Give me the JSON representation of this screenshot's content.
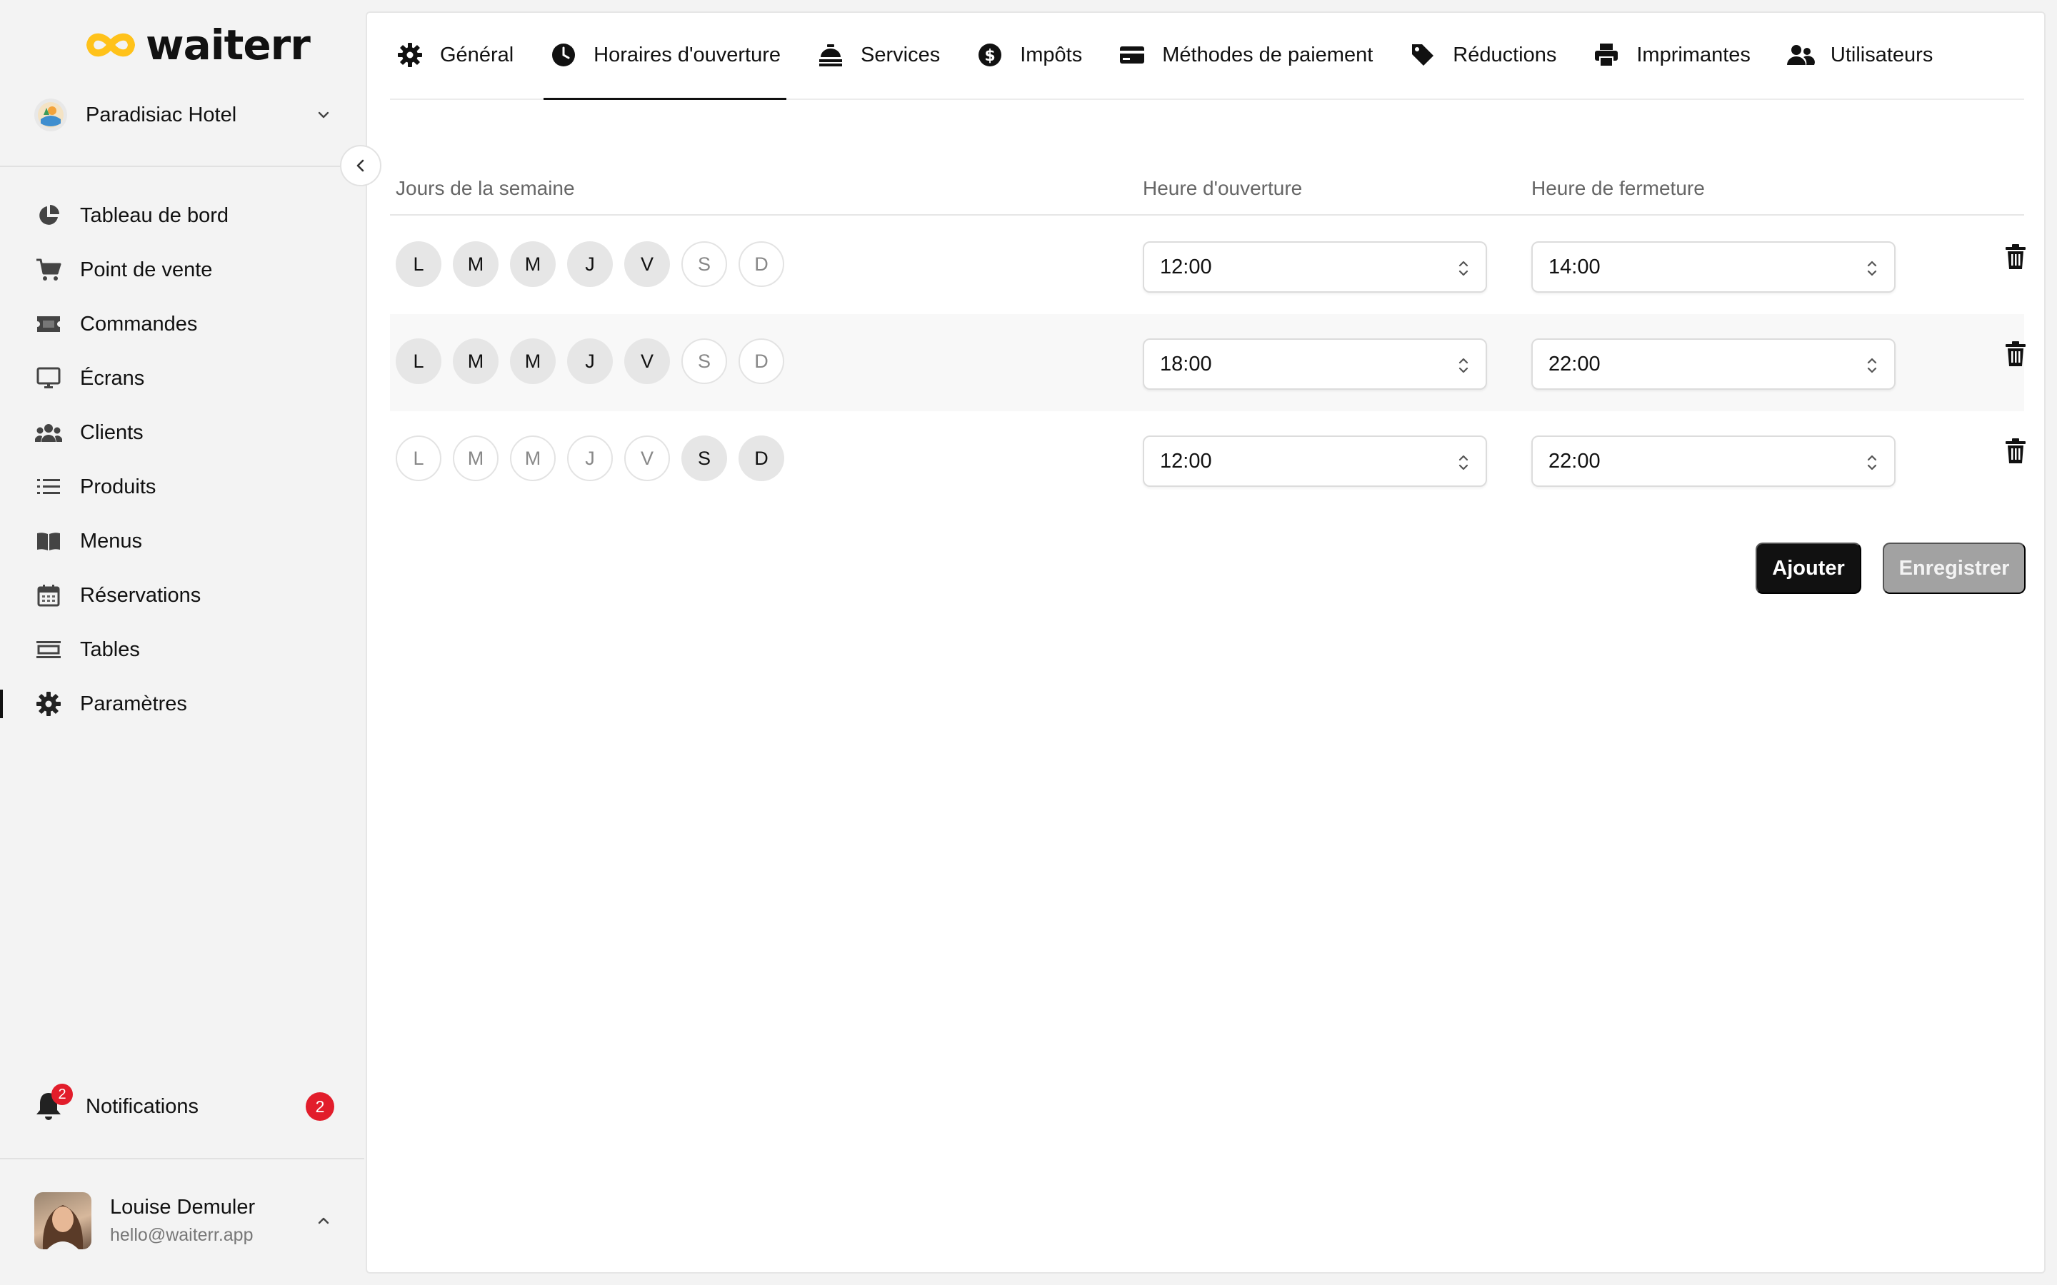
{
  "brand": {
    "name": "waiterr",
    "accent": "#FFC21A"
  },
  "workspace": {
    "name": "Paradisiac Hotel"
  },
  "nav": {
    "items": [
      {
        "label": "Tableau de bord",
        "icon": "pie-chart-icon"
      },
      {
        "label": "Point de vente",
        "icon": "cart-icon"
      },
      {
        "label": "Commandes",
        "icon": "ticket-icon"
      },
      {
        "label": "Écrans",
        "icon": "monitor-icon"
      },
      {
        "label": "Clients",
        "icon": "users-icon"
      },
      {
        "label": "Produits",
        "icon": "list-icon"
      },
      {
        "label": "Menus",
        "icon": "book-icon"
      },
      {
        "label": "Réservations",
        "icon": "calendar-icon"
      },
      {
        "label": "Tables",
        "icon": "table-icon"
      },
      {
        "label": "Paramètres",
        "icon": "gear-icon",
        "active": true
      }
    ]
  },
  "notifications": {
    "label": "Notifications",
    "count": "2"
  },
  "user": {
    "name": "Louise Demuler",
    "email": "hello@waiterr.app"
  },
  "tabs": [
    {
      "label": "Général",
      "icon": "gear-icon"
    },
    {
      "label": "Horaires d'ouverture",
      "icon": "clock-icon",
      "active": true
    },
    {
      "label": "Services",
      "icon": "bell-service-icon"
    },
    {
      "label": "Impôts",
      "icon": "dollar-coin-icon"
    },
    {
      "label": "Méthodes de paiement",
      "icon": "credit-card-icon"
    },
    {
      "label": "Réductions",
      "icon": "tag-icon"
    },
    {
      "label": "Imprimantes",
      "icon": "printer-icon"
    },
    {
      "label": "Utilisateurs",
      "icon": "user-group-icon"
    }
  ],
  "schedule": {
    "headers": {
      "days": "Jours de la semaine",
      "open": "Heure d'ouverture",
      "close": "Heure de fermeture"
    },
    "day_letters": [
      "L",
      "M",
      "M",
      "J",
      "V",
      "S",
      "D"
    ],
    "rows": [
      {
        "days": [
          true,
          true,
          true,
          true,
          true,
          false,
          false
        ],
        "open": "12:00",
        "close": "14:00"
      },
      {
        "days": [
          true,
          true,
          true,
          true,
          true,
          false,
          false
        ],
        "open": "18:00",
        "close": "22:00"
      },
      {
        "days": [
          false,
          false,
          false,
          false,
          false,
          true,
          true
        ],
        "open": "12:00",
        "close": "22:00"
      }
    ]
  },
  "actions": {
    "add": "Ajouter",
    "save": "Enregistrer"
  },
  "colors": {
    "badge": "#E21D2B",
    "primary_button": "#111111",
    "disabled_button": "#A2A2A2"
  }
}
